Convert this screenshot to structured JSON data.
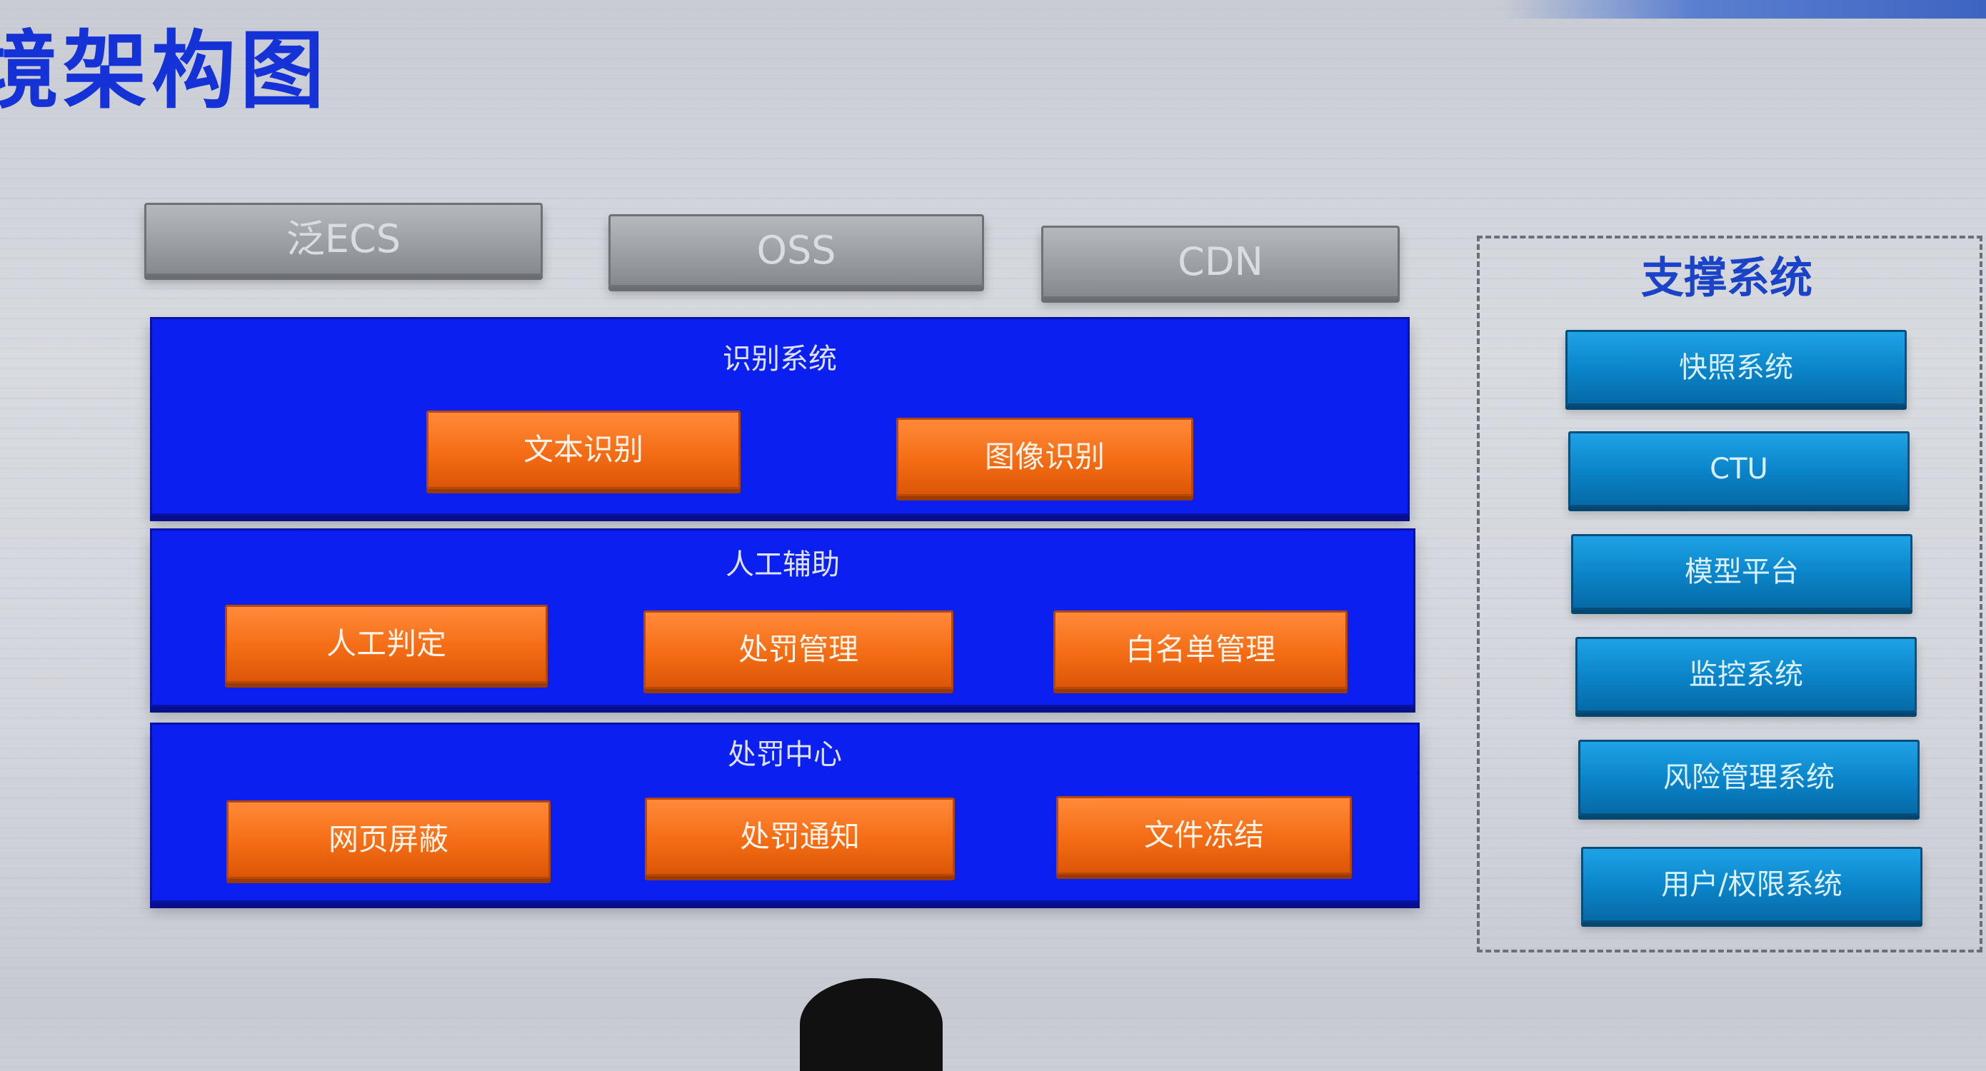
{
  "title": "境架构图",
  "infrastructure": [
    "泛ECS",
    "OSS",
    "CDN"
  ],
  "layers": [
    {
      "title": "识别系统",
      "items": [
        "文本识别",
        "图像识别"
      ]
    },
    {
      "title": "人工辅助",
      "items": [
        "人工判定",
        "处罚管理",
        "白名单管理"
      ]
    },
    {
      "title": "处罚中心",
      "items": [
        "网页屏蔽",
        "处罚通知",
        "文件冻结"
      ]
    }
  ],
  "support": {
    "title": "支撑系统",
    "items": [
      "快照系统",
      "CTU",
      "模型平台",
      "监控系统",
      "风险管理系统",
      "用户/权限系统"
    ]
  },
  "colors": {
    "title": "#1532d6",
    "layer_panel": "#0a1ff0",
    "module_button": "#f46c14",
    "support_button": "#0b86cb",
    "infrastructure_button": "#9c9fa4"
  }
}
